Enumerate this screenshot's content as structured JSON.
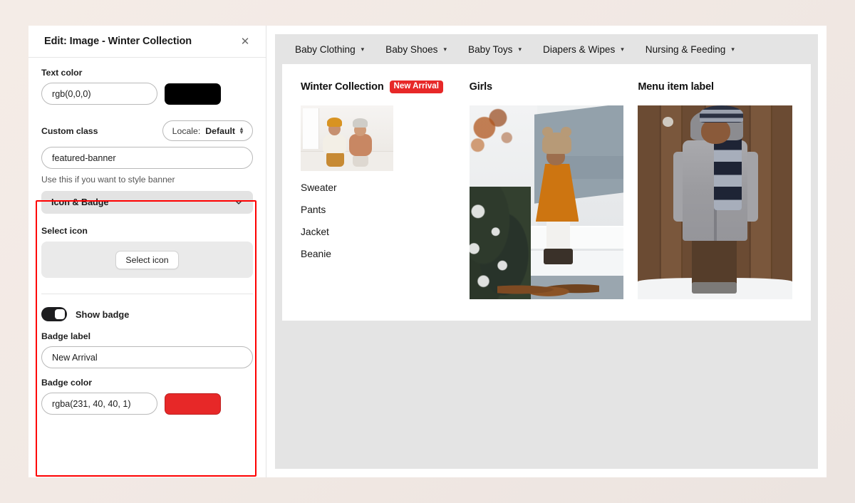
{
  "editor": {
    "title": "Edit: Image - Winter Collection",
    "close_icon": "close-icon",
    "text_color": {
      "label": "Text color",
      "value": "rgb(0,0,0)",
      "swatch_color": "#000000"
    },
    "custom_class": {
      "label": "Custom class",
      "value": "featured-banner",
      "help": "Use this if you want to style banner"
    },
    "locale": {
      "prefix": "Locale: ",
      "value": "Default"
    },
    "icon_badge_section": {
      "title": "Icon & Badge",
      "chevron_icon": "chevron-down-icon",
      "select_icon_label": "Select icon",
      "select_icon_button": "Select icon",
      "show_badge_label": "Show badge",
      "badge_label_field": {
        "label": "Badge label",
        "value": "New Arrival"
      },
      "badge_color_field": {
        "label": "Badge color",
        "value": "rgba(231, 40, 40, 1)",
        "swatch_color": "#e72828"
      }
    }
  },
  "preview": {
    "nav": [
      {
        "label": "Baby Clothing",
        "caret": "chevron-down-icon"
      },
      {
        "label": "Baby Shoes",
        "caret": "chevron-down-icon"
      },
      {
        "label": "Baby Toys",
        "caret": "chevron-down-icon"
      },
      {
        "label": "Diapers & Wipes",
        "caret": "chevron-down-icon"
      },
      {
        "label": "Nursing & Feeding",
        "caret": "chevron-down-icon"
      }
    ],
    "columns": [
      {
        "title": "Winter Collection",
        "badge": "New Arrival",
        "image_alt": "two toddlers in winter knitwear",
        "links": [
          "Sweater",
          "Pants",
          "Jacket",
          "Beanie"
        ]
      },
      {
        "title": "Girls",
        "image_alt": "girl in orange dress on snowy steps"
      },
      {
        "title": "Menu item label",
        "image_alt": "child in grey duffle coat by wooden wall"
      }
    ]
  },
  "colors": {
    "accent_red": "#e72828",
    "highlight_outline": "#fe0000",
    "panel_gray": "#e4e4e4",
    "page_background": "#f2e9e4"
  }
}
